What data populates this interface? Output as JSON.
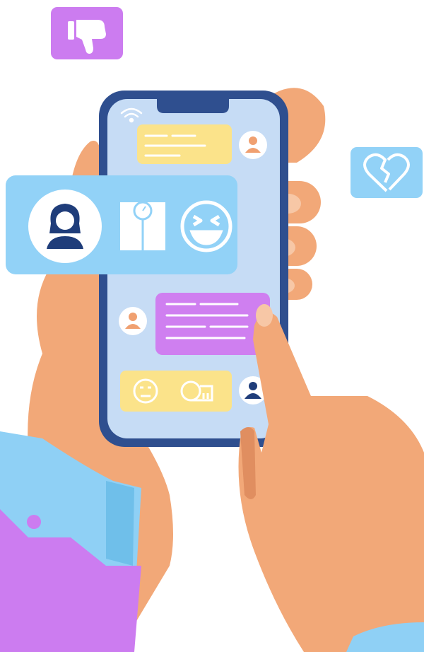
{
  "palette": {
    "skin": "#f2a878",
    "skin_dark": "#e08e60",
    "nail": "#f7c7a6",
    "sleeve_blue": "#8fd0f5",
    "sleeve_blue_dark": "#6fbfea",
    "shirt_purple": "#cc7cf0",
    "phone_frame": "#2f4f8f",
    "phone_screen": "#c6dcf5",
    "bubble_yellow": "#fbe38a",
    "bubble_purple": "#cf7ff0",
    "card_blue": "#92d2f7",
    "avatar_orange": "#f0a070",
    "navy": "#1f3d7a",
    "white": "#ffffff"
  },
  "icons": {
    "thumbs_down": "thumbs-down-icon",
    "broken_heart": "broken-heart-icon",
    "woman_avatar": "woman-avatar-icon",
    "scale": "scale-icon",
    "laughing_face": "laughing-face-icon",
    "neutral_face": "neutral-face-icon",
    "measuring_tape": "measuring-tape-icon",
    "man_avatar": "man-avatar-icon"
  }
}
